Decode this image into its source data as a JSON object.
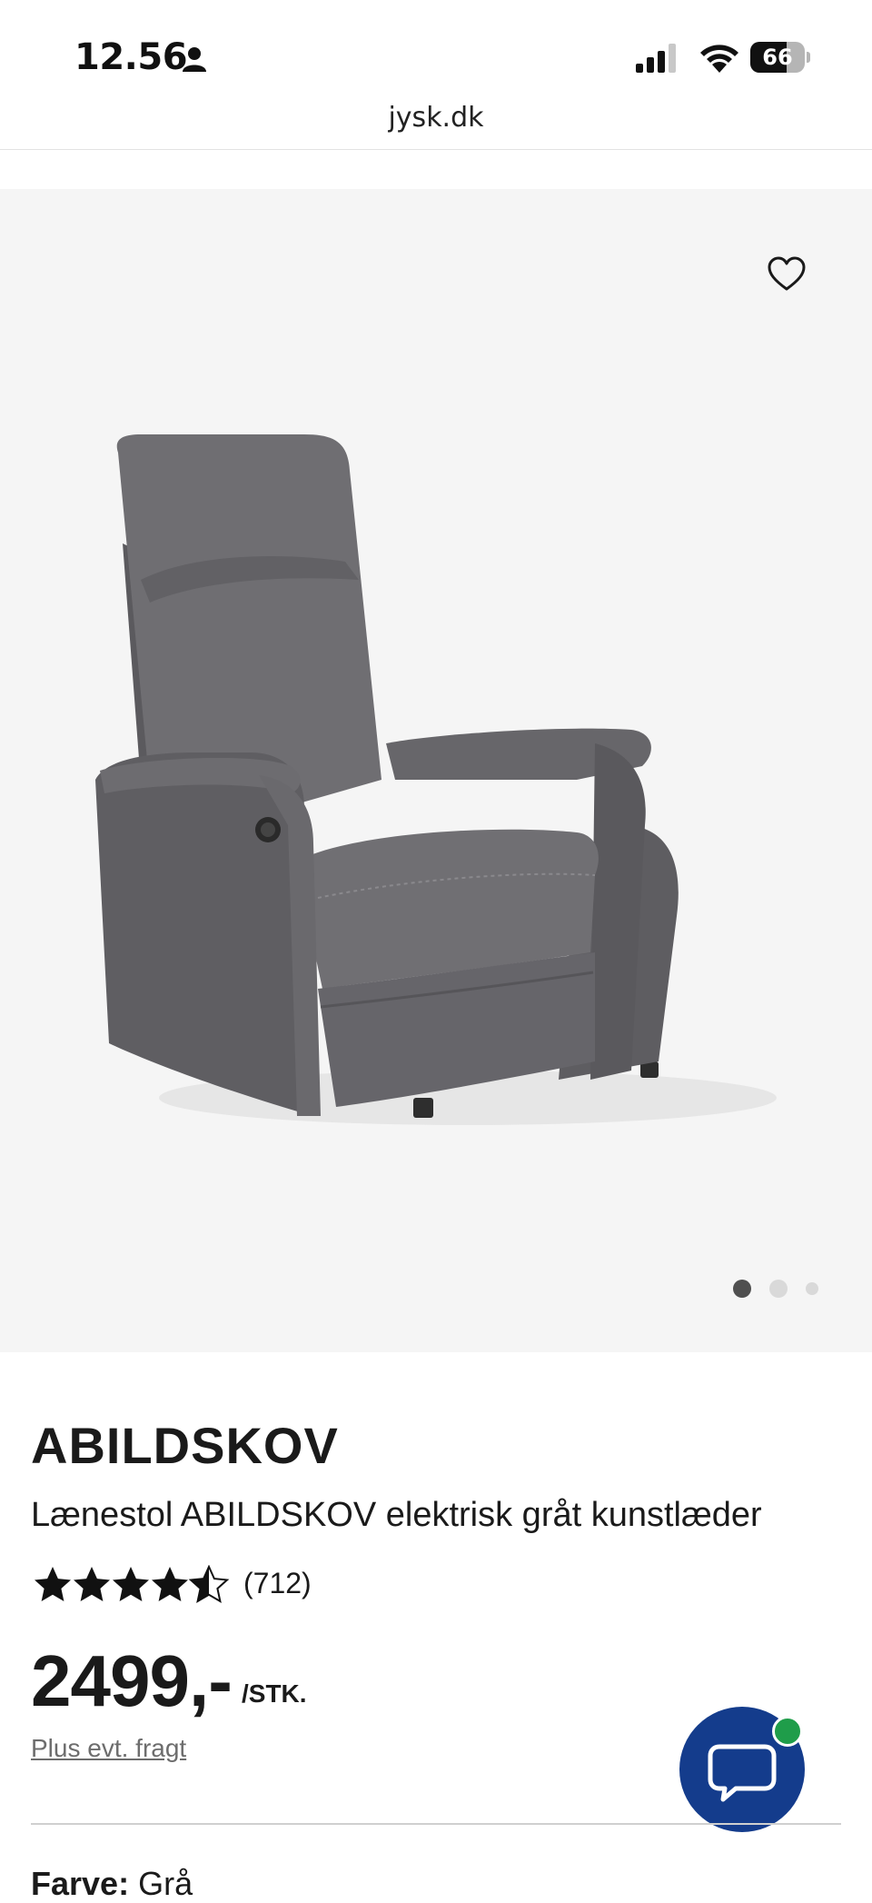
{
  "status_bar": {
    "time": "12.56",
    "battery": "66",
    "battery_level": 0.66
  },
  "browser": {
    "url": "jysk.dk"
  },
  "gallery": {
    "image_count": 3,
    "active_index": 0
  },
  "product": {
    "brand": "ABILDSKOV",
    "title": "Lænestol ABILDSKOV elektrisk gråt kunstlæder",
    "rating_stars": 4.5,
    "review_count": "(712)",
    "price": "2499,-",
    "unit": "/STK.",
    "shipping_link": "Plus evt. fragt",
    "color_label": "Farve:",
    "color_value": "Grå"
  },
  "colors": {
    "accent": "#143c8c",
    "online": "#1f9d4a",
    "gallery_bg": "#f5f5f5"
  },
  "icons": {
    "favorite": "heart-outline-icon",
    "chat": "chat-bubble-icon"
  }
}
